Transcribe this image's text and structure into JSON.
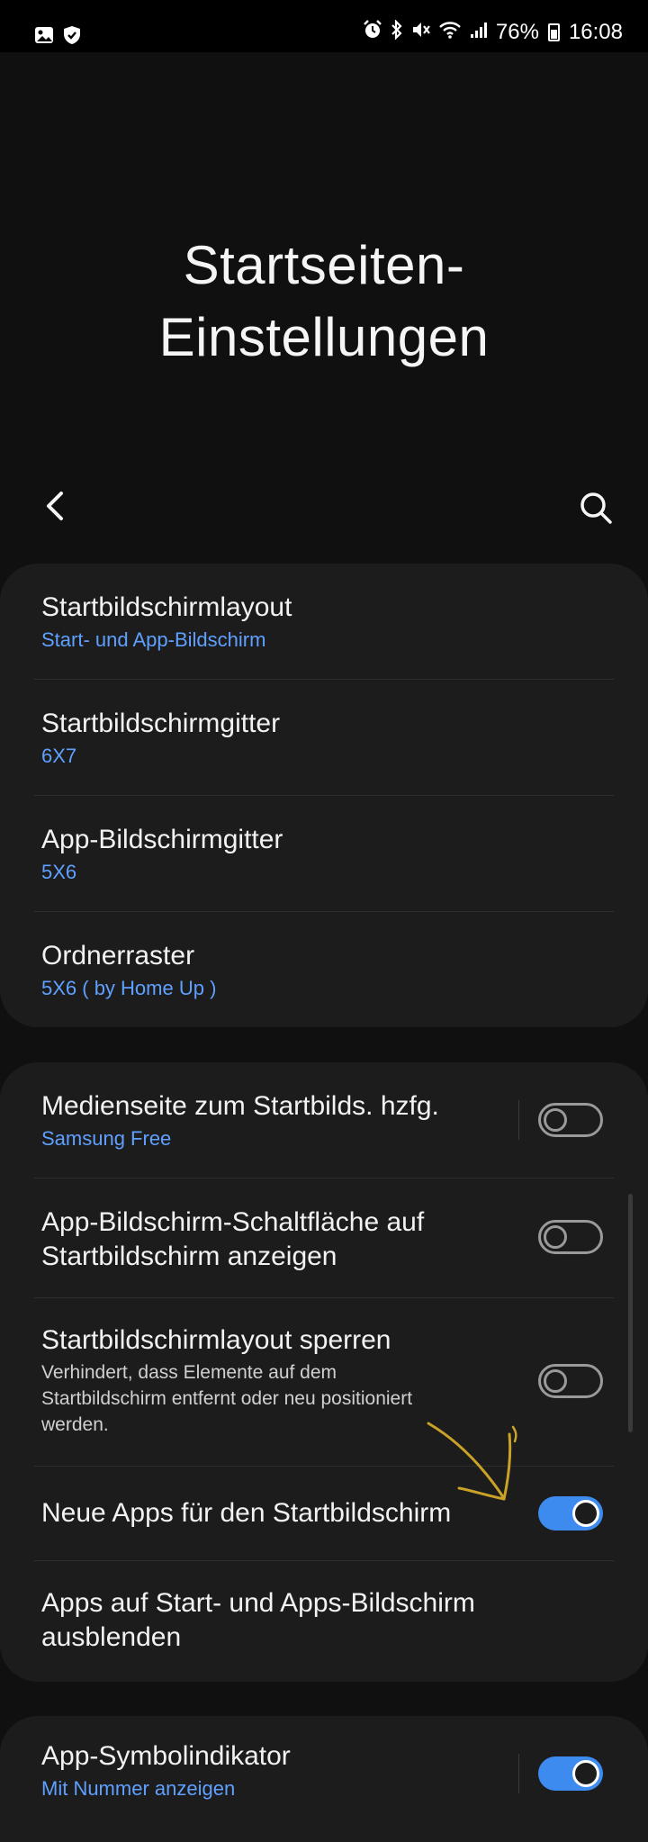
{
  "status_bar": {
    "battery": "76%",
    "time": "16:08",
    "left_icons": [
      "gallery-icon",
      "shield-icon"
    ],
    "right_icons": [
      "alarm-icon",
      "bluetooth-icon",
      "mute-icon",
      "wifi-icon",
      "signal-icon",
      "battery-icon"
    ]
  },
  "header": {
    "title_line1": "Startseiten-",
    "title_line2": "Einstellungen"
  },
  "toolbar": {
    "back_icon": "chevron-left-icon",
    "search_icon": "search-icon"
  },
  "group1": {
    "items": [
      {
        "title": "Startbildschirmlayout",
        "subtitle": "Start- und App-Bildschirm"
      },
      {
        "title": "Startbildschirmgitter",
        "subtitle": "6X7"
      },
      {
        "title": "App-Bildschirmgitter",
        "subtitle": "5X6"
      },
      {
        "title": "Ordnerraster",
        "subtitle": "5X6 ( by Home Up )"
      }
    ]
  },
  "group2": {
    "items": [
      {
        "title": "Medienseite zum Startbilds. hzfg.",
        "subtitle": "Samsung Free",
        "toggle_on": false
      },
      {
        "title_line1": "App-Bildschirm-Schaltfläche auf",
        "title_line2": "Startbildschirm anzeigen",
        "toggle_on": false
      },
      {
        "title": "Startbildschirmlayout sperren",
        "desc_line1": "Verhindert, dass Elemente auf dem",
        "desc_line2": "Startbildschirm entfernt oder neu positioniert",
        "desc_line3": "werden.",
        "toggle_on": false
      },
      {
        "title": "Neue Apps für den Startbildschirm",
        "toggle_on": true
      },
      {
        "title_line1": "Apps auf Start- und Apps-Bildschirm",
        "title_line2": "ausblenden"
      }
    ]
  },
  "group3": {
    "items": [
      {
        "title": "App-Symbolindikator",
        "subtitle": "Mit Nummer anzeigen",
        "toggle_on": true
      }
    ]
  },
  "colors": {
    "background": "#101010",
    "card": "#1c1c1c",
    "accent": "#3e8bf0",
    "subtitle": "#5fa0ff",
    "annotation_arrow": "#c9a227"
  }
}
